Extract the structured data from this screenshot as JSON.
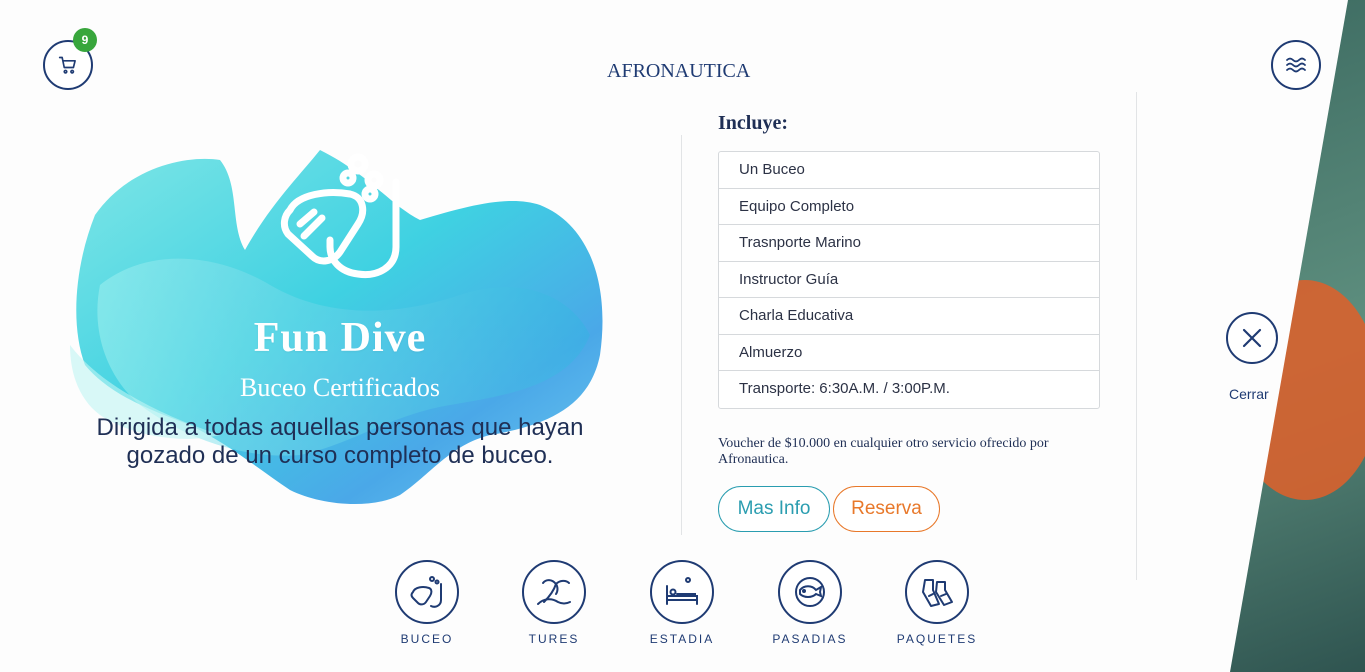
{
  "header": {
    "cart_count": "9",
    "logo_text": "AFRONAUTICA"
  },
  "product": {
    "title": "Fun Dive",
    "subtitle": "Buceo Certificados",
    "description": "Dirigida a todas aquellas personas que hayan gozado de un curso completo de buceo."
  },
  "includes": {
    "title": "Incluye:",
    "items": [
      "Un Buceo",
      "Equipo Completo",
      "Trasnporte Marino",
      "Instructor Guía",
      "Charla Educativa",
      "Almuerzo",
      "Transporte: 6:30A.M. / 3:00P.M."
    ],
    "voucher": "Voucher de $10.000 en cualquier otro servicio ofrecido por Afronautica."
  },
  "actions": {
    "more_info": "Mas Info",
    "reserve": "Reserva"
  },
  "close": {
    "label": "Cerrar"
  },
  "nav": [
    {
      "label": "BUCEO",
      "icon": "diving-mask-icon"
    },
    {
      "label": "TURES",
      "icon": "palm-tree-icon"
    },
    {
      "label": "ESTADIA",
      "icon": "bed-icon"
    },
    {
      "label": "PASADIAS",
      "icon": "fish-icon"
    },
    {
      "label": "PAQUETES",
      "icon": "fins-icon"
    }
  ],
  "colors": {
    "navy": "#1f3b73",
    "teal": "#2a9db0",
    "orange": "#e8782a",
    "badge_green": "#38a63c"
  }
}
